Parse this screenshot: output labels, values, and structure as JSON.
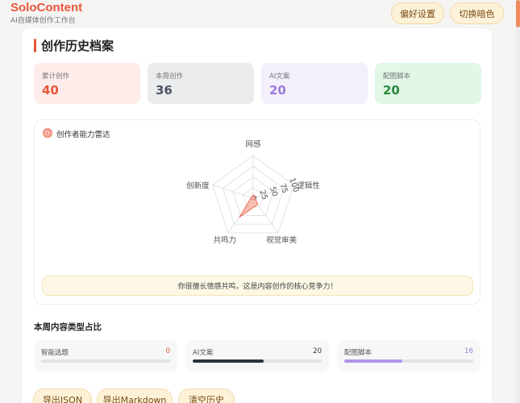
{
  "app": {
    "name": "SoloContent",
    "subtitle": "AI自媒体创作工作台"
  },
  "topbar": {
    "preferences_label": "偏好设置",
    "theme_toggle_label": "切换暗色"
  },
  "page": {
    "title": "创作历史档案"
  },
  "stats": [
    {
      "label": "累计创作",
      "value": "40",
      "color": "#e8563a",
      "bg": "#fdecea"
    },
    {
      "label": "本周创作",
      "value": "36",
      "color": "#4b5563",
      "bg": "#ebecee"
    },
    {
      "label": "AI文案",
      "value": "20",
      "color": "#9a7bd9",
      "bg": "#f3effb"
    },
    {
      "label": "配图脚本",
      "value": "20",
      "color": "#2a8a3e",
      "bg": "#e2f7e6"
    }
  ],
  "radar": {
    "title": "创作者能力雷达",
    "icon": "target-icon",
    "axes": [
      "网感",
      "逻辑性",
      "视觉审美",
      "共鸣力",
      "创新度"
    ],
    "values": [
      8,
      5,
      18,
      55,
      5
    ],
    "ticks": [
      "0",
      "25",
      "50",
      "75",
      "100"
    ],
    "max": 100,
    "fill": "#f5a89a",
    "stroke": "#e8563a",
    "tip": "你很擅长情感共鸣，这是内容创作的核心竞争力！"
  },
  "distribution": {
    "title": "本周内容类型占比",
    "items": [
      {
        "label": "智能选题",
        "count": "0",
        "ratio": 0,
        "color": "#e8563a",
        "bar": "#e8563a"
      },
      {
        "label": "AI文案",
        "count": "20",
        "ratio": 0.55,
        "color": "#333333",
        "bar": "#2a3140"
      },
      {
        "label": "配图脚本",
        "count": "16",
        "ratio": 0.45,
        "color": "#9a7bd9",
        "bar": "#b393ea"
      }
    ]
  },
  "actions": {
    "export_json": "导出JSON",
    "export_markdown": "导出Markdown",
    "clear_history": "清空历史"
  }
}
